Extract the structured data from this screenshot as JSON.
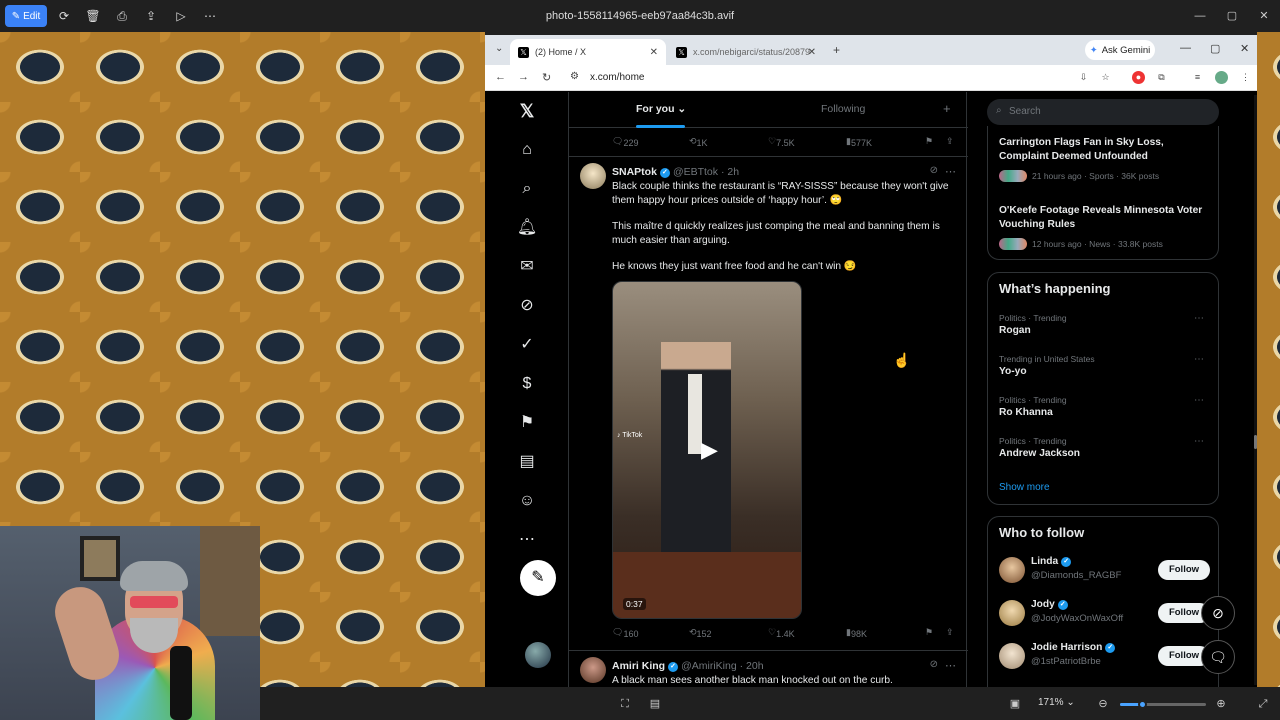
{
  "viewer": {
    "edit_label": "Edit",
    "title": "photo-1558114965-eeb97aa84c3b.avif",
    "zoom": "171%",
    "zoom_level_fraction": 0.25
  },
  "browser": {
    "tabs": [
      {
        "label": "(2) Home / X"
      },
      {
        "label": "x.com/nebigarci/status/208796"
      }
    ],
    "gemini_label": "Ask Gemini",
    "url": "x.com/home"
  },
  "feed": {
    "tab_for_you": "For you",
    "tab_following": "Following",
    "top_actions": {
      "replies": "229",
      "reposts": "1K",
      "likes": "7.5K",
      "views": "577K"
    },
    "tweet1": {
      "name": "SNAPtok",
      "handle": "@EBTtok · 2h",
      "line1": "Black couple thinks the restaurant is “RAY-SISSS” because they won't give them happy hour prices outside of ‘happy hour’. 🙄",
      "line2": "This maître d quickly realizes just comping the meal and banning them is much easier than arguing.",
      "line3": "He knows they just want free food and he can't win 😏",
      "video_time": "0:37",
      "tiktok_label": "TikTok",
      "actions": {
        "replies": "160",
        "reposts": "152",
        "likes": "1.4K",
        "views": "98K"
      }
    },
    "tweet2": {
      "name": "Amiri King",
      "handle": "@AmiriKing · 20h",
      "text": "A black man sees another black man knocked out on the curb."
    }
  },
  "sidebar": {
    "search_placeholder": "Search",
    "trends_top": [
      {
        "title": "Carrington Flags Fan in Sky Loss, Complaint Deemed Unfounded",
        "meta": "21 hours ago · Sports · 36K posts"
      },
      {
        "title": "O'Keefe Footage Reveals Minnesota Voter Vouching Rules",
        "meta": "12 hours ago · News · 33.8K posts"
      }
    ],
    "whats_happening_title": "What’s happening",
    "whats_happening": [
      {
        "category": "Politics · Trending",
        "name": "Rogan"
      },
      {
        "category": "Trending in United States",
        "name": "Yo-yo"
      },
      {
        "category": "Politics · Trending",
        "name": "Ro Khanna"
      },
      {
        "category": "Politics · Trending",
        "name": "Andrew Jackson"
      }
    ],
    "show_more": "Show more",
    "who_to_follow_title": "Who to follow",
    "who_to_follow": [
      {
        "name": "Linda",
        "handle": "@Diamonds_RAGBF",
        "button": "Follow"
      },
      {
        "name": "Jody",
        "handle": "@JodyWaxOnWaxOff",
        "button": "Follow"
      },
      {
        "name": "Jodie Harrison",
        "handle": "@1stPatriotBrbe",
        "button": "Follow"
      }
    ]
  },
  "colors": {
    "accent": "#1d9bf0",
    "background": "#000000",
    "text": "#e7e9ea",
    "muted": "#71767b"
  }
}
